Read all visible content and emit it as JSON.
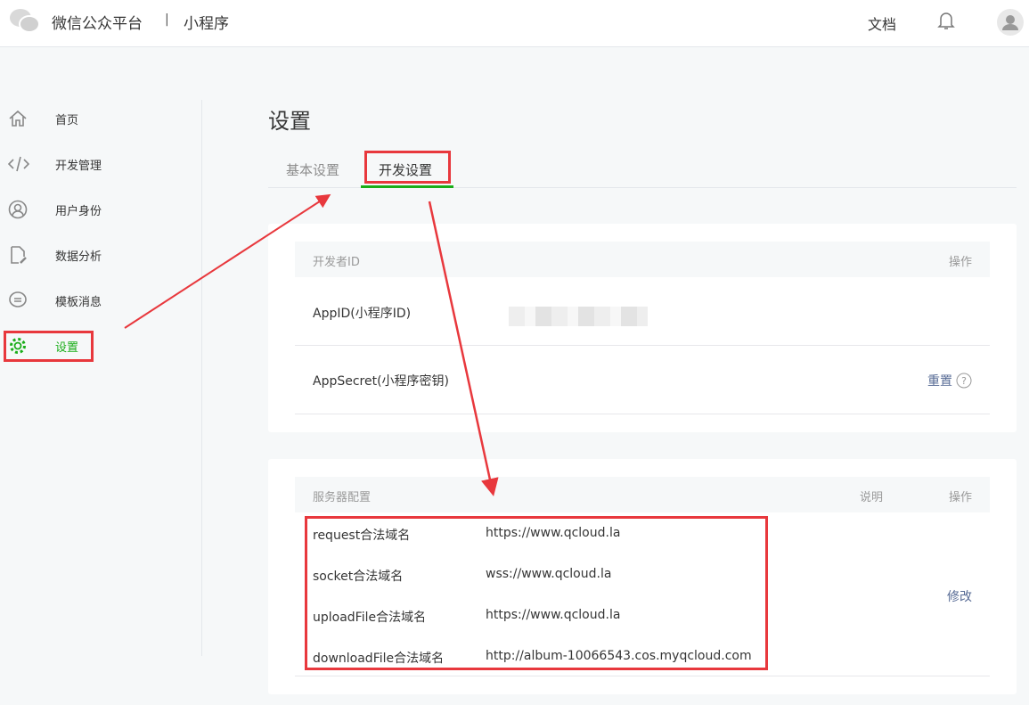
{
  "header": {
    "brand": "微信公众平台",
    "separator": "|",
    "product": "小程序",
    "docs": "文档"
  },
  "sidebar": {
    "items": [
      {
        "label": "首页",
        "icon": "home-icon"
      },
      {
        "label": "开发管理",
        "icon": "code-icon"
      },
      {
        "label": "用户身份",
        "icon": "user-icon"
      },
      {
        "label": "数据分析",
        "icon": "document-edit-icon"
      },
      {
        "label": "模板消息",
        "icon": "message-icon"
      },
      {
        "label": "设置",
        "icon": "gear-icon",
        "active": true
      }
    ]
  },
  "page": {
    "title": "设置",
    "tabs": [
      {
        "label": "基本设置"
      },
      {
        "label": "开发设置",
        "active": true
      }
    ]
  },
  "developer_id": {
    "header": "开发者ID",
    "action_header": "操作",
    "rows": [
      {
        "label": "AppID(小程序ID)",
        "value": ""
      },
      {
        "label": "AppSecret(小程序密钥)",
        "action": "重置"
      }
    ]
  },
  "server": {
    "header": "服务器配置",
    "desc_header": "说明",
    "action_header": "操作",
    "action": "修改",
    "rows": [
      {
        "label": "request合法域名",
        "value": "https://www.qcloud.la"
      },
      {
        "label": "socket合法域名",
        "value": "wss://www.qcloud.la"
      },
      {
        "label": "uploadFile合法域名",
        "value": "https://www.qcloud.la"
      },
      {
        "label": "downloadFile合法域名",
        "value": "http://album-10066543.cos.myqcloud.com"
      }
    ]
  },
  "colors": {
    "accent": "#1aad19",
    "link": "#576b95",
    "annotation": "#e8383d"
  }
}
